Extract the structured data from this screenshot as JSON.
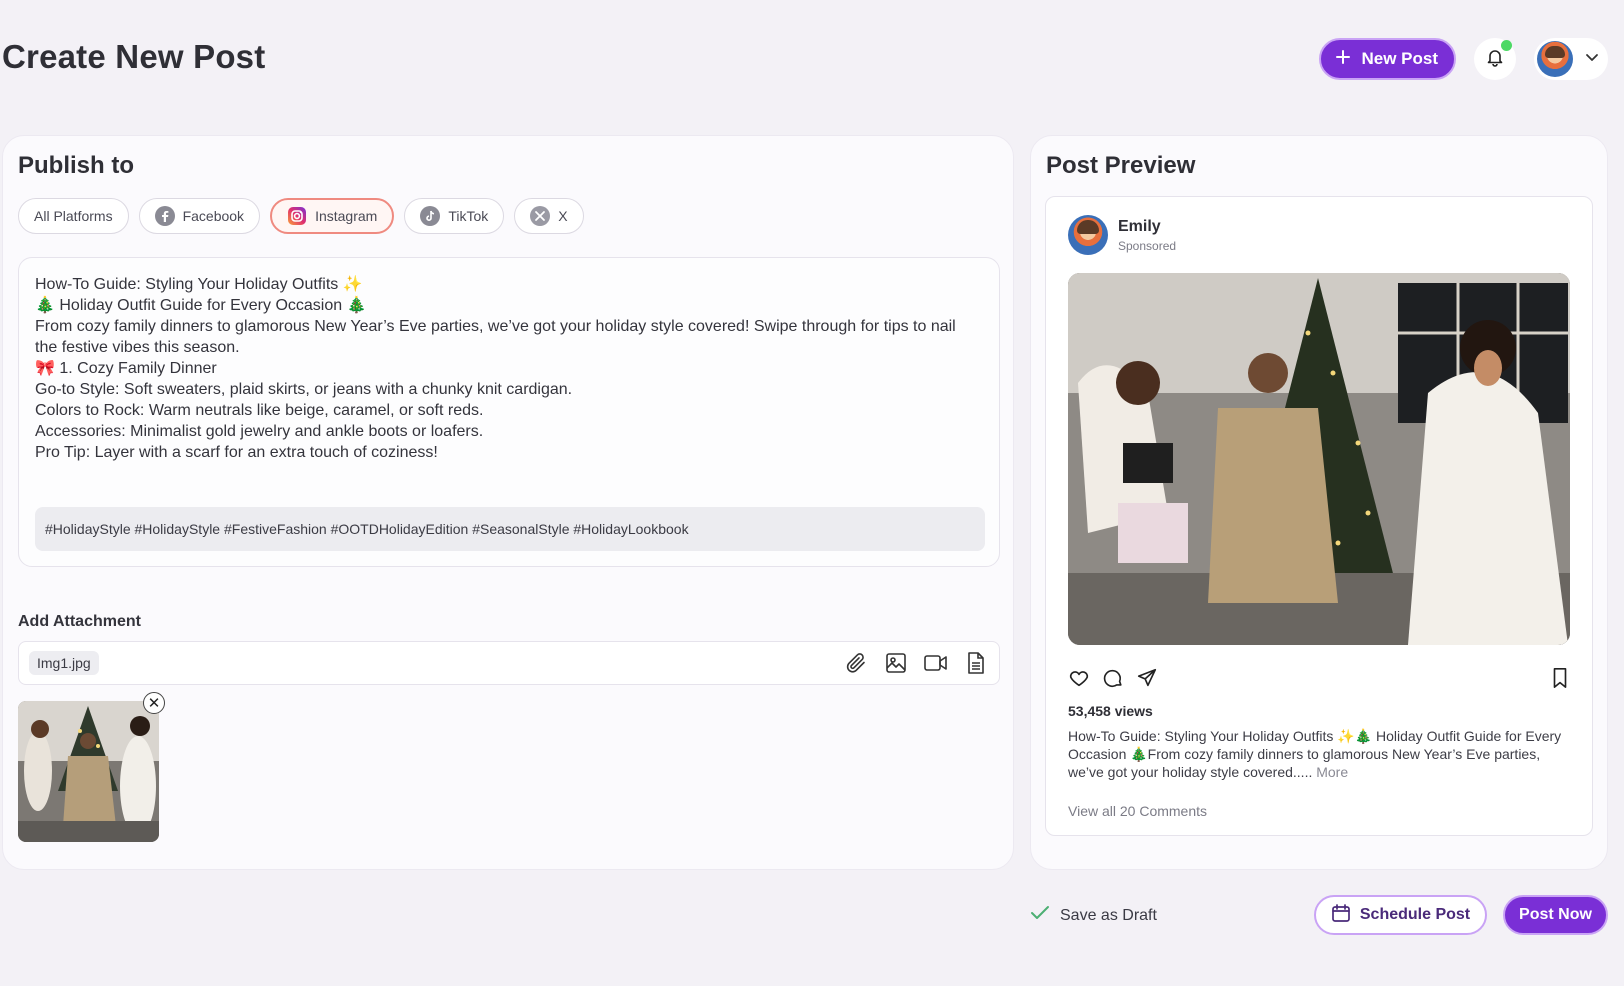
{
  "header": {
    "title": "Create New Post",
    "new_post_label": "New Post",
    "notification_dot_color": "#4cd964"
  },
  "publish": {
    "title": "Publish to",
    "platforms": [
      {
        "label": "All Platforms",
        "icon": "none",
        "active": false
      },
      {
        "label": "Facebook",
        "icon": "facebook-icon",
        "active": false
      },
      {
        "label": "Instagram",
        "icon": "instagram-icon",
        "active": true
      },
      {
        "label": "TikTok",
        "icon": "tiktok-icon",
        "active": false
      },
      {
        "label": "X",
        "icon": "x-icon",
        "active": false
      }
    ],
    "body_lines": [
      "How-To Guide: Styling Your Holiday Outfits ✨",
      "🎄 Holiday Outfit Guide for Every Occasion 🎄",
      "From cozy family dinners to glamorous New Year’s Eve parties, we’ve got your holiday style covered! Swipe through for tips to nail the festive vibes this season.",
      "🎀 1. Cozy Family Dinner",
      "Go-to Style: Soft sweaters, plaid skirts, or jeans with a chunky knit cardigan.",
      "Colors to Rock: Warm neutrals like beige, caramel, or soft reds.",
      "Accessories: Minimalist gold jewelry and ankle boots or loafers.",
      "Pro Tip: Layer with a scarf for an extra touch of coziness!"
    ],
    "hashtags": "#HolidayStyle #HolidayStyle #FestiveFashion #OOTDHolidayEdition #SeasonalStyle #HolidayLookbook"
  },
  "attachment": {
    "label": "Add Attachment",
    "file_name": "Img1.jpg",
    "icons": [
      "paperclip-icon",
      "image-icon",
      "video-icon",
      "document-icon"
    ]
  },
  "preview": {
    "title": "Post Preview",
    "user_name": "Emily",
    "sponsored": "Sponsored",
    "views": "53,458 views",
    "caption": "How-To Guide: Styling Your Holiday Outfits ✨🎄 Holiday Outfit Guide for Every Occasion 🎄From cozy family dinners to glamorous New Year’s Eve parties, we’ve got your holiday style covered.....",
    "more": "More",
    "comments": "View all 20 Comments"
  },
  "footer": {
    "draft_label": "Save as Draft",
    "schedule_label": "Schedule Post",
    "post_now_label": "Post Now"
  },
  "colors": {
    "accent": "#7a2fd6",
    "accent_border": "#c9a3f5",
    "active_chip_border": "#ef8a80",
    "background": "#f3f1f6"
  }
}
